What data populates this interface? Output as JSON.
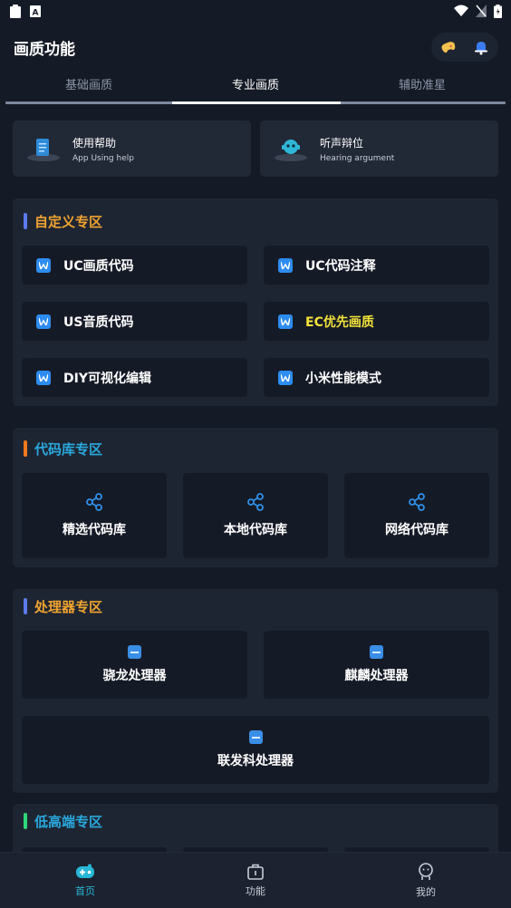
{
  "app_title": "画质功能",
  "tabs": [
    {
      "label": "基础画质",
      "active": false
    },
    {
      "label": "专业画质",
      "active": true
    },
    {
      "label": "辅助准星",
      "active": false
    }
  ],
  "help_cards": [
    {
      "title": "使用帮助",
      "subtitle": "App Using help",
      "icon": "document-device-icon"
    },
    {
      "title": "听声辩位",
      "subtitle": "Hearing argument",
      "icon": "robot-device-icon"
    }
  ],
  "sections": {
    "custom": {
      "title": "自定义专区",
      "bar_color": "#5b7cf0",
      "title_color": "#f0a330",
      "items": [
        {
          "label": "UC画质代码",
          "color": "#ffffff"
        },
        {
          "label": "UC代码注释",
          "color": "#ffffff"
        },
        {
          "label": "US音质代码",
          "color": "#ffffff"
        },
        {
          "label": "EC优先画质",
          "color": "#f2e23a"
        },
        {
          "label": "DIY可视化编辑",
          "color": "#ffffff"
        },
        {
          "label": "小米性能模式",
          "color": "#ffffff"
        }
      ]
    },
    "codelib": {
      "title": "代码库专区",
      "bar_color": "#f07a1e",
      "title_color": "#29a9de",
      "items": [
        {
          "label": "精选代码库"
        },
        {
          "label": "本地代码库"
        },
        {
          "label": "网络代码库"
        }
      ]
    },
    "processor": {
      "title": "处理器专区",
      "bar_color": "#5b7cf0",
      "title_color": "#f0a330",
      "items": [
        {
          "label": "骁龙处理器"
        },
        {
          "label": "麒麟处理器"
        },
        {
          "label": "联发科处理器"
        }
      ]
    },
    "lowhigh": {
      "title": "低高端专区",
      "bar_color": "#2fd67a",
      "title_color": "#29a9de"
    }
  },
  "bottom_nav": [
    {
      "label": "首页",
      "active": true,
      "icon": "gamepad-icon"
    },
    {
      "label": "功能",
      "active": false,
      "icon": "toolbox-icon"
    },
    {
      "label": "我的",
      "active": false,
      "icon": "profile-icon"
    }
  ],
  "colors": {
    "background": "#151b26",
    "card": "#1e2532",
    "accent": "#27b7d6"
  }
}
